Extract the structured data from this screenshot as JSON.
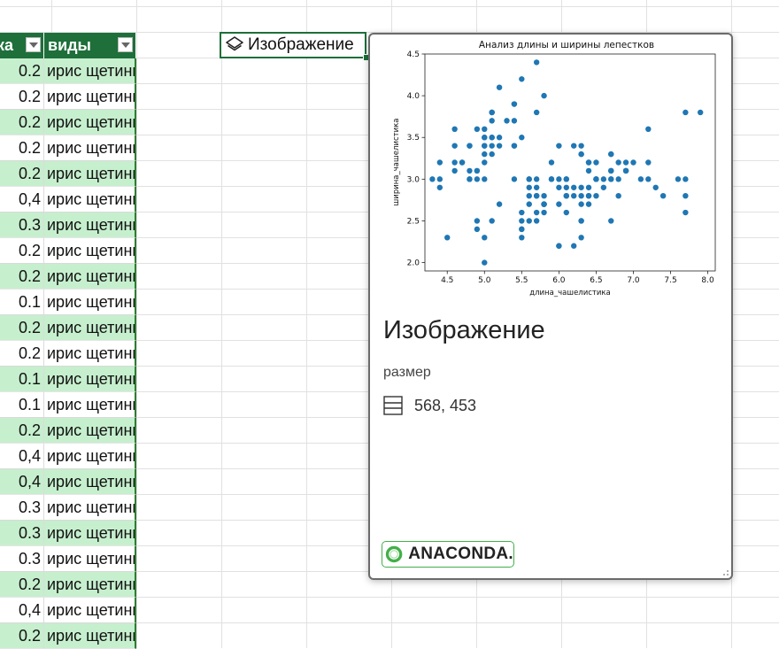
{
  "table": {
    "header_a": "ка",
    "header_b": "виды",
    "rows": [
      {
        "a": "0.2",
        "b": "ирис щетинистый"
      },
      {
        "a": "0.2",
        "b": "ирис щетинистый"
      },
      {
        "a": "0.2",
        "b": "ирис щетинистый"
      },
      {
        "a": "0.2",
        "b": "ирис щетинистый"
      },
      {
        "a": "0.2",
        "b": "ирис щетинистый"
      },
      {
        "a": "0,4",
        "b": "ирис щетинистый"
      },
      {
        "a": "0.3",
        "b": "ирис щетинистый"
      },
      {
        "a": "0.2",
        "b": "ирис щетинистый"
      },
      {
        "a": "0.2",
        "b": "ирис щетинистый"
      },
      {
        "a": "0.1",
        "b": "ирис щетинистый"
      },
      {
        "a": "0.2",
        "b": "ирис щетинистый"
      },
      {
        "a": "0.2",
        "b": "ирис щетинистый"
      },
      {
        "a": "0.1",
        "b": "ирис щетинистый"
      },
      {
        "a": "0.1",
        "b": "ирис щетинистый"
      },
      {
        "a": "0.2",
        "b": "ирис щетинистый"
      },
      {
        "a": "0,4",
        "b": "ирис щетинистый"
      },
      {
        "a": "0,4",
        "b": "ирис щетинистый"
      },
      {
        "a": "0.3",
        "b": "ирис щетинистый"
      },
      {
        "a": "0.3",
        "b": "ирис щетинистый"
      },
      {
        "a": "0.3",
        "b": "ирис щетинистый"
      },
      {
        "a": "0.2",
        "b": "ирис щетинистый"
      },
      {
        "a": "0,4",
        "b": "ирис щетинистый"
      },
      {
        "a": "0.2",
        "b": "ирис щетинистый"
      }
    ]
  },
  "selected_cell": {
    "label": "Изображение",
    "icon": "image-layers-icon"
  },
  "card": {
    "title": "Изображение",
    "size_label": "размер",
    "size_icon": "table-rows-icon",
    "size_value": "568, 453",
    "logo_text": "ANACONDA."
  },
  "colors": {
    "table_header": "#1e6f3a",
    "band": "#c6efce",
    "point": "#1f77b4",
    "logo_green": "#43b049"
  },
  "chart_data": {
    "type": "scatter",
    "title": "Анализ длины и ширины лепестков",
    "xlabel": "длина_чашелистика",
    "ylabel": "ширина_чашелистика",
    "xlim": [
      4.2,
      8.1
    ],
    "ylim": [
      1.9,
      4.5
    ],
    "xticks": [
      "4.5",
      "5.0",
      "5.5",
      "6.0",
      "6.5",
      "7.0",
      "7.5",
      "8.0"
    ],
    "yticks": [
      "2.0",
      "2.5",
      "3.0",
      "3.5",
      "4.0",
      "4.5"
    ],
    "grid": false,
    "points": [
      [
        5.1,
        3.5
      ],
      [
        4.9,
        3.0
      ],
      [
        4.7,
        3.2
      ],
      [
        4.6,
        3.1
      ],
      [
        5.0,
        3.6
      ],
      [
        5.4,
        3.9
      ],
      [
        4.6,
        3.4
      ],
      [
        5.0,
        3.4
      ],
      [
        4.4,
        2.9
      ],
      [
        4.9,
        3.1
      ],
      [
        5.4,
        3.7
      ],
      [
        4.8,
        3.4
      ],
      [
        4.8,
        3.0
      ],
      [
        4.3,
        3.0
      ],
      [
        5.8,
        4.0
      ],
      [
        5.7,
        4.4
      ],
      [
        5.4,
        3.9
      ],
      [
        5.1,
        3.5
      ],
      [
        5.7,
        3.8
      ],
      [
        5.1,
        3.8
      ],
      [
        5.4,
        3.4
      ],
      [
        5.1,
        3.7
      ],
      [
        4.6,
        3.6
      ],
      [
        5.1,
        3.3
      ],
      [
        4.8,
        3.4
      ],
      [
        5.0,
        3.0
      ],
      [
        5.0,
        3.4
      ],
      [
        5.2,
        3.5
      ],
      [
        5.2,
        3.4
      ],
      [
        4.7,
        3.2
      ],
      [
        4.8,
        3.1
      ],
      [
        5.4,
        3.4
      ],
      [
        5.2,
        4.1
      ],
      [
        5.5,
        4.2
      ],
      [
        4.9,
        3.1
      ],
      [
        5.0,
        3.2
      ],
      [
        5.5,
        3.5
      ],
      [
        4.9,
        3.6
      ],
      [
        4.4,
        3.0
      ],
      [
        5.1,
        3.4
      ],
      [
        5.0,
        3.5
      ],
      [
        4.5,
        2.3
      ],
      [
        4.4,
        3.2
      ],
      [
        5.0,
        3.5
      ],
      [
        5.1,
        3.8
      ],
      [
        4.8,
        3.0
      ],
      [
        5.1,
        3.8
      ],
      [
        4.6,
        3.2
      ],
      [
        5.3,
        3.7
      ],
      [
        5.0,
        3.3
      ],
      [
        7.0,
        3.2
      ],
      [
        6.4,
        3.2
      ],
      [
        6.9,
        3.1
      ],
      [
        5.5,
        2.3
      ],
      [
        6.5,
        2.8
      ],
      [
        5.7,
        2.8
      ],
      [
        6.3,
        3.3
      ],
      [
        4.9,
        2.4
      ],
      [
        6.6,
        2.9
      ],
      [
        5.2,
        2.7
      ],
      [
        5.0,
        2.0
      ],
      [
        5.9,
        3.0
      ],
      [
        6.0,
        2.2
      ],
      [
        6.1,
        2.9
      ],
      [
        5.6,
        2.9
      ],
      [
        6.7,
        3.1
      ],
      [
        5.6,
        3.0
      ],
      [
        5.8,
        2.7
      ],
      [
        6.2,
        2.2
      ],
      [
        5.6,
        2.5
      ],
      [
        5.9,
        3.2
      ],
      [
        6.1,
        2.8
      ],
      [
        6.3,
        2.5
      ],
      [
        6.1,
        2.8
      ],
      [
        6.4,
        2.9
      ],
      [
        6.6,
        3.0
      ],
      [
        6.8,
        2.8
      ],
      [
        6.7,
        3.0
      ],
      [
        6.0,
        2.9
      ],
      [
        5.7,
        2.6
      ],
      [
        5.5,
        2.4
      ],
      [
        5.5,
        2.4
      ],
      [
        5.8,
        2.7
      ],
      [
        6.0,
        2.7
      ],
      [
        5.4,
        3.0
      ],
      [
        6.0,
        3.4
      ],
      [
        6.7,
        3.1
      ],
      [
        6.3,
        2.3
      ],
      [
        5.6,
        3.0
      ],
      [
        5.5,
        2.5
      ],
      [
        5.5,
        2.6
      ],
      [
        6.1,
        3.0
      ],
      [
        5.8,
        2.6
      ],
      [
        5.0,
        2.3
      ],
      [
        5.6,
        2.7
      ],
      [
        5.7,
        3.0
      ],
      [
        5.7,
        2.9
      ],
      [
        6.2,
        2.9
      ],
      [
        5.1,
        2.5
      ],
      [
        5.7,
        2.8
      ],
      [
        6.3,
        3.3
      ],
      [
        5.8,
        2.7
      ],
      [
        7.1,
        3.0
      ],
      [
        6.3,
        2.9
      ],
      [
        6.5,
        3.0
      ],
      [
        7.6,
        3.0
      ],
      [
        4.9,
        2.5
      ],
      [
        7.3,
        2.9
      ],
      [
        6.7,
        2.5
      ],
      [
        7.2,
        3.6
      ],
      [
        6.5,
        3.2
      ],
      [
        6.4,
        2.7
      ],
      [
        6.8,
        3.0
      ],
      [
        5.7,
        2.5
      ],
      [
        5.8,
        2.8
      ],
      [
        6.4,
        3.2
      ],
      [
        6.5,
        3.0
      ],
      [
        7.7,
        3.8
      ],
      [
        7.7,
        2.6
      ],
      [
        6.0,
        2.2
      ],
      [
        6.9,
        3.2
      ],
      [
        5.6,
        2.8
      ],
      [
        7.7,
        2.8
      ],
      [
        6.3,
        2.7
      ],
      [
        6.7,
        3.3
      ],
      [
        7.2,
        3.2
      ],
      [
        6.2,
        2.8
      ],
      [
        6.1,
        3.0
      ],
      [
        6.4,
        2.8
      ],
      [
        7.2,
        3.0
      ],
      [
        7.4,
        2.8
      ],
      [
        7.9,
        3.8
      ],
      [
        6.4,
        2.8
      ],
      [
        6.3,
        2.8
      ],
      [
        6.1,
        2.6
      ],
      [
        7.7,
        3.0
      ],
      [
        6.3,
        3.4
      ],
      [
        6.4,
        3.1
      ],
      [
        6.0,
        3.0
      ],
      [
        6.9,
        3.1
      ],
      [
        6.7,
        3.1
      ],
      [
        6.9,
        3.1
      ],
      [
        5.8,
        2.7
      ],
      [
        6.8,
        3.2
      ],
      [
        6.7,
        3.3
      ],
      [
        6.7,
        3.0
      ],
      [
        6.3,
        2.5
      ],
      [
        6.5,
        3.0
      ],
      [
        6.2,
        3.4
      ],
      [
        5.9,
        3.0
      ]
    ]
  }
}
